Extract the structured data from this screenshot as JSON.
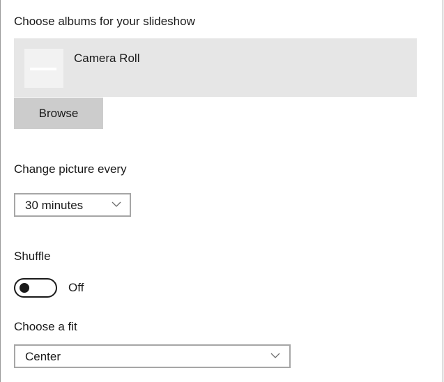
{
  "albums": {
    "heading": "Choose albums for your slideshow",
    "items": [
      {
        "name": "Camera Roll"
      }
    ],
    "browse_label": "Browse"
  },
  "interval": {
    "label": "Change picture every",
    "selected": "30 minutes"
  },
  "shuffle": {
    "label": "Shuffle",
    "state_text": "Off",
    "on": false
  },
  "fit": {
    "label": "Choose a fit",
    "selected": "Center"
  },
  "icons": {
    "album_thumbnail": "photo-placeholder-icon",
    "dropdown": "chevron-down-icon"
  }
}
